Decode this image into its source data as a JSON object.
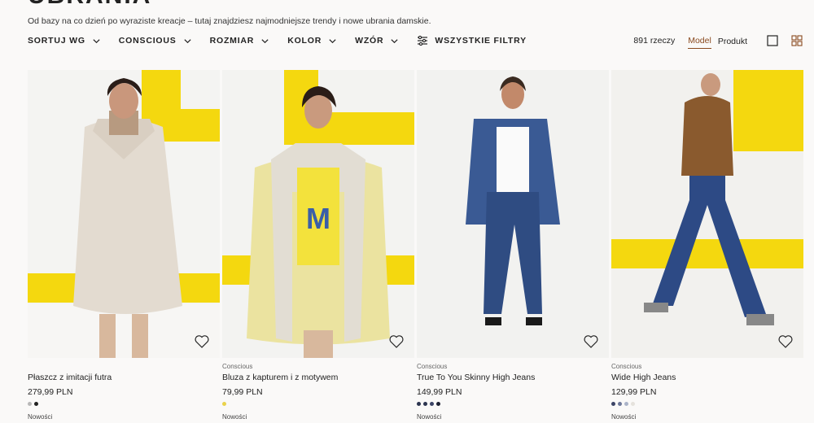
{
  "header": {
    "title": "UBRANIA",
    "description": "Od bazy na co dzień po wyraziste kreacje – tutaj znajdziesz najmodniejsze trendy i nowe ubrania damskie."
  },
  "filters": [
    {
      "label": "SORTUJ WG"
    },
    {
      "label": "CONSCIOUS"
    },
    {
      "label": "ROZMIAR"
    },
    {
      "label": "KOLOR"
    },
    {
      "label": "WZÓR"
    }
  ],
  "all_filters_label": "WSZYSTKIE FILTRY",
  "view": {
    "count": "891 rzeczy",
    "model_label": "Model",
    "product_label": "Produkt",
    "accent": "#8a4a1f"
  },
  "products": [
    {
      "tag": "",
      "name": "Płaszcz z imitacji futra",
      "price": "279,99 PLN",
      "badge": "Nowości",
      "swatches": [
        "#b8b8b8",
        "#222222"
      ],
      "icon": "heart-icon"
    },
    {
      "tag": "Conscious",
      "name": "Bluza z kapturem i z motywem",
      "price": "79,99 PLN",
      "badge": "Nowości",
      "swatches": [
        "#e9d24a"
      ],
      "icon": "heart-icon"
    },
    {
      "tag": "Conscious",
      "name": "True To You Skinny High Jeans",
      "price": "149,99 PLN",
      "badge": "Nowości",
      "swatches": [
        "#2c3550",
        "#2c3550",
        "#3b4466",
        "#1e2233"
      ],
      "icon": "heart-icon"
    },
    {
      "tag": "Conscious",
      "name": "Wide High Jeans",
      "price": "129,99 PLN",
      "badge": "Nowości",
      "swatches": [
        "#3b4466",
        "#6d7899",
        "#aab3c8",
        "#e5e2dc"
      ],
      "icon": "heart-icon"
    }
  ]
}
